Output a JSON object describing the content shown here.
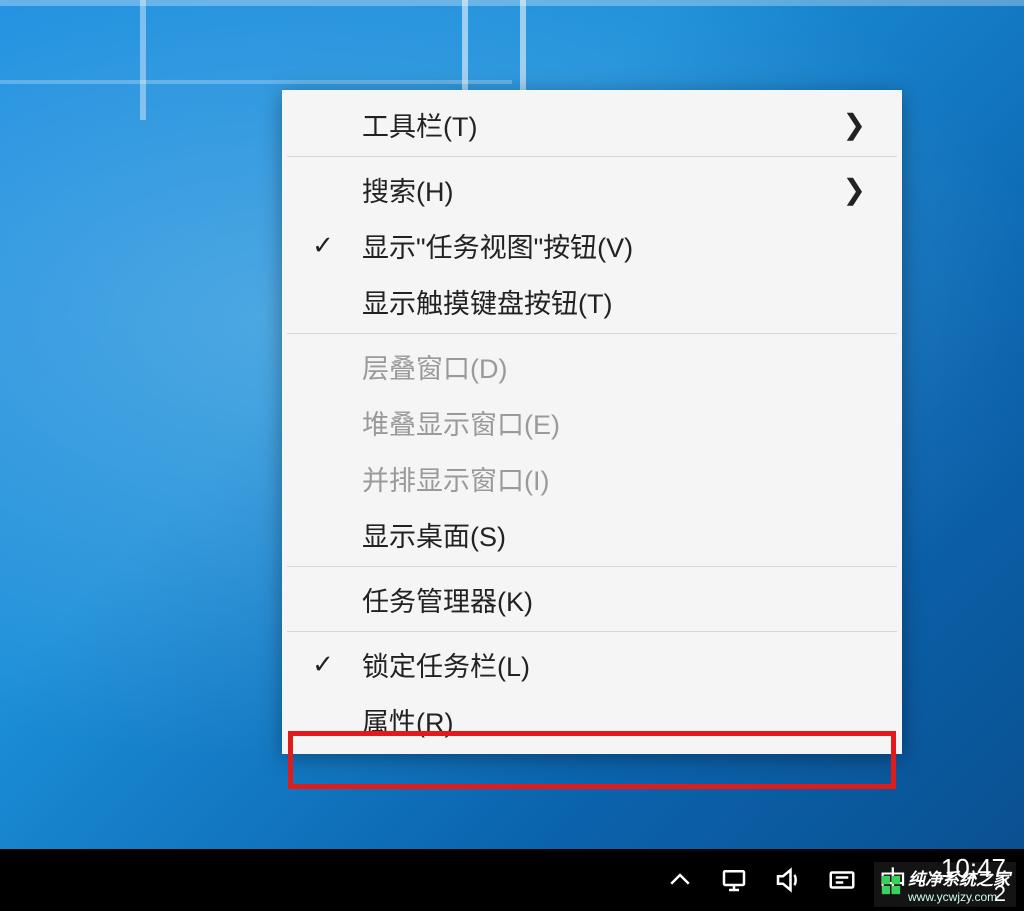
{
  "menu": {
    "items": [
      {
        "id": "toolbars",
        "label": "工具栏(T)",
        "checked": false,
        "submenu": true,
        "enabled": true
      },
      {
        "id": "search",
        "label": "搜索(H)",
        "checked": false,
        "submenu": true,
        "enabled": true
      },
      {
        "id": "show-task-view",
        "label": "显示\"任务视图\"按钮(V)",
        "checked": true,
        "submenu": false,
        "enabled": true
      },
      {
        "id": "show-touch-kb",
        "label": "显示触摸键盘按钮(T)",
        "checked": false,
        "submenu": false,
        "enabled": true
      },
      {
        "id": "cascade",
        "label": "层叠窗口(D)",
        "checked": false,
        "submenu": false,
        "enabled": false
      },
      {
        "id": "stack",
        "label": "堆叠显示窗口(E)",
        "checked": false,
        "submenu": false,
        "enabled": false
      },
      {
        "id": "side-by-side",
        "label": "并排显示窗口(I)",
        "checked": false,
        "submenu": false,
        "enabled": false
      },
      {
        "id": "show-desktop",
        "label": "显示桌面(S)",
        "checked": false,
        "submenu": false,
        "enabled": true
      },
      {
        "id": "task-manager",
        "label": "任务管理器(K)",
        "checked": false,
        "submenu": false,
        "enabled": true
      },
      {
        "id": "lock-taskbar",
        "label": "锁定任务栏(L)",
        "checked": true,
        "submenu": false,
        "enabled": true,
        "highlighted": true
      },
      {
        "id": "properties",
        "label": "属性(R)",
        "checked": false,
        "submenu": false,
        "enabled": true
      }
    ]
  },
  "tray": {
    "up_icon": "show-hidden-icons",
    "network_icon": "network-icon",
    "volume_icon": "volume-icon",
    "ime_sub_icon": "ime-options-icon",
    "ime_label": "中",
    "clock": "10:47",
    "clock_extra": "2"
  },
  "watermark": {
    "label": "纯净系统之家",
    "url": "www.ycwjzy.com"
  }
}
